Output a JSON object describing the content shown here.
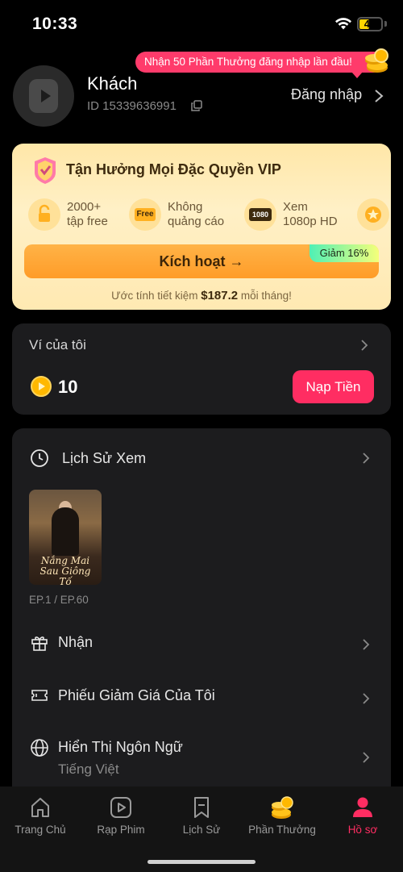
{
  "status_bar": {
    "time": "10:33",
    "battery": "41"
  },
  "profile": {
    "login_banner": "Nhận 50 Phần Thưởng đăng nhập lần đầu!",
    "name": "Khách",
    "id": "ID 15339636991",
    "login_label": "Đăng nhập"
  },
  "vip": {
    "title": "Tận Hưởng Mọi Đặc Quyền VIP",
    "benefits": [
      {
        "icon": "lock-open-icon",
        "line1": "2000+",
        "line2": "tập free"
      },
      {
        "icon": "free-tag-icon",
        "icon_text": "Free",
        "line1": "Không",
        "line2": "quảng cáo"
      },
      {
        "icon": "hd-1080-icon",
        "icon_text": "1080",
        "line1": "Xem",
        "line2": "1080p HD"
      },
      {
        "icon": "star-badge-icon",
        "line1": "",
        "line2": ""
      }
    ],
    "activate_label": "Kích hoạt →",
    "discount_label": "Giảm 16%",
    "savings_prefix": "Ước tính tiết kiệm ",
    "savings_amount": "$187.2",
    "savings_suffix": " mỗi tháng!"
  },
  "wallet": {
    "title": "Ví của tôi",
    "coins": "10",
    "topup_label": "Nạp Tiền"
  },
  "menu": {
    "history_label": "Lịch Sử Xem",
    "history_item": {
      "poster_title_1": "Nắng Mai",
      "poster_title_2": "Sau Giông Tố",
      "episode": "EP.1 / EP.60"
    },
    "receive_label": "Nhận",
    "coupons_label": "Phiếu Giảm Giá Của Tôi",
    "language_label": "Hiển Thị Ngôn Ngữ",
    "language_value": "Tiếng Việt"
  },
  "nav": {
    "items": [
      {
        "label": "Trang Chủ",
        "icon": "home-icon"
      },
      {
        "label": "Rạp Phim",
        "icon": "play-square-icon"
      },
      {
        "label": "Lịch Sử",
        "icon": "bookmark-icon"
      },
      {
        "label": "Phần Thưởng",
        "icon": "coins-icon"
      },
      {
        "label": "Hồ sơ",
        "icon": "profile-icon",
        "active": true
      }
    ],
    "accent_color": "#ff2d62"
  }
}
